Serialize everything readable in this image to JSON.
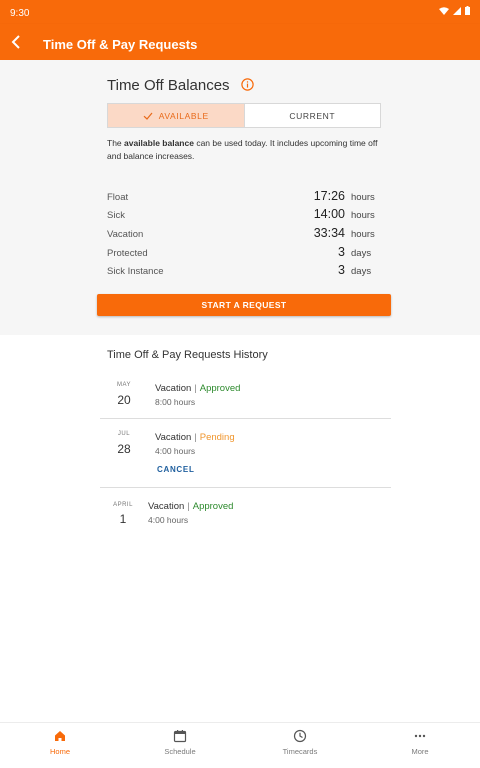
{
  "status_bar": {
    "time": "9:30"
  },
  "app_bar": {
    "title": "Time Off & Pay Requests",
    "back_icon": "back-arrow-icon"
  },
  "balances": {
    "title": "Time Off Balances",
    "info_icon": "info-icon",
    "tabs": [
      {
        "label": "AVAILABLE",
        "active": true,
        "icon": "check-icon"
      },
      {
        "label": "CURRENT",
        "active": false
      }
    ],
    "description": {
      "prefix": "The ",
      "bold": "available balance",
      "suffix": " can be used today. It includes upcoming time off and balance increases."
    },
    "rows": [
      {
        "label": "Float",
        "value": "17:26",
        "unit": "hours"
      },
      {
        "label": "Sick",
        "value": "14:00",
        "unit": "hours"
      },
      {
        "label": "Vacation",
        "value": "33:34",
        "unit": "hours"
      },
      {
        "label": "Protected",
        "value": "3",
        "unit": "days"
      },
      {
        "label": "Sick Instance",
        "value": "3",
        "unit": "days"
      }
    ],
    "cta_label": "START A REQUEST"
  },
  "history": {
    "title": "Time Off & Pay Requests History",
    "items": [
      {
        "month": "MAY",
        "day": "20",
        "type": "Vacation",
        "separator": "|",
        "status": "Approved",
        "duration": "8:00 hours"
      },
      {
        "month": "JUL",
        "day": "28",
        "type": "Vacation",
        "separator": "|",
        "status": "Pending",
        "duration": "4:00 hours",
        "action": "CANCEL"
      },
      {
        "month": "APRIL",
        "day": "1",
        "type": "Vacation",
        "separator": "|",
        "status": "Approved",
        "duration": "4:00 hours"
      }
    ]
  },
  "bottom_nav": [
    {
      "label": "Home",
      "icon": "home-icon",
      "active": true
    },
    {
      "label": "Schedule",
      "icon": "calendar-icon",
      "active": false
    },
    {
      "label": "Timecards",
      "icon": "clock-icon",
      "active": false
    },
    {
      "label": "More",
      "icon": "more-icon",
      "active": false
    }
  ],
  "colors": {
    "brand": "#f86a0a",
    "approved": "#2d8a2d",
    "pending": "#f0962e",
    "link": "#1f5f9e"
  }
}
